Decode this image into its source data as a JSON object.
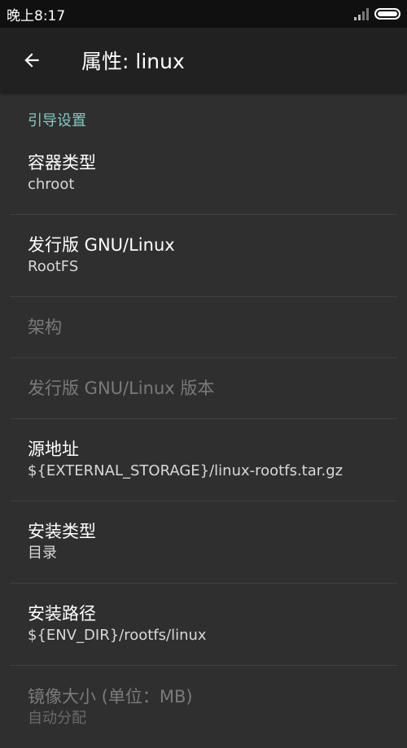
{
  "status": {
    "time": "晚上8:17"
  },
  "toolbar": {
    "title": "属性: linux"
  },
  "category": "引导设置",
  "prefs": [
    {
      "title": "容器类型",
      "summary": "chroot"
    },
    {
      "title": "发行版 GNU/Linux",
      "summary": "RootFS"
    },
    {
      "title": "架构"
    },
    {
      "title": "发行版 GNU/Linux 版本"
    },
    {
      "title": "源地址",
      "summary": "${EXTERNAL_STORAGE}/linux-rootfs.tar.gz"
    },
    {
      "title": "安装类型",
      "summary": "目录"
    },
    {
      "title": "安装路径",
      "summary": "${ENV_DIR}/rootfs/linux"
    },
    {
      "title": "镜像大小 (单位：MB)",
      "summary": "自动分配"
    }
  ],
  "colors": {
    "accent": "#80cbc4",
    "toolbar": "#212121",
    "background": "#2f2f2f"
  }
}
